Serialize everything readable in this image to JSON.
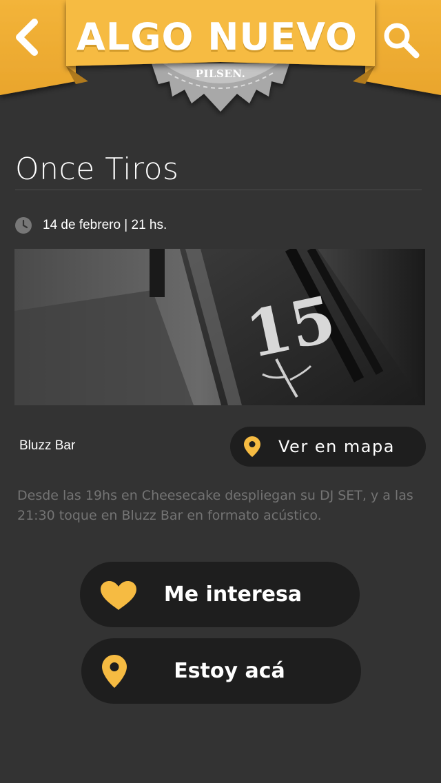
{
  "colors": {
    "accent": "#f6bb42",
    "background": "#333333",
    "button": "#1e1e1e"
  },
  "header": {
    "brand_title": "ALGO NUEVO",
    "badge_label": "PILSEN.",
    "back_icon": "chevron-left-icon",
    "search_icon": "search-icon"
  },
  "event": {
    "title": "Once Tiros",
    "datetime": "14 de febrero | 21 hs.",
    "venue": "Bluzz Bar",
    "description": "Desde las 19hs en Cheesecake despliegan su DJ SET, y a las 21:30 toque en Bluzz Bar en formato acústico."
  },
  "map_button": {
    "label": "Ver en mapa",
    "icon": "map-pin-icon"
  },
  "actions": {
    "interest": {
      "label": "Me interesa",
      "icon": "heart-icon"
    },
    "here": {
      "label": "Estoy acá",
      "icon": "map-pin-icon"
    }
  },
  "image": {
    "number": "15"
  }
}
